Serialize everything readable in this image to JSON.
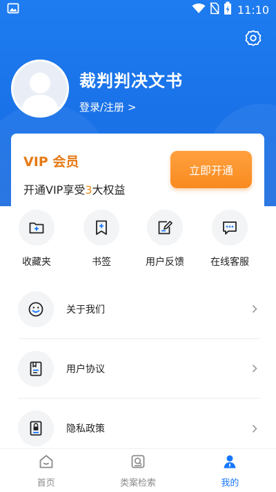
{
  "status_bar": {
    "time": "11:10"
  },
  "profile": {
    "app_title": "裁判判决文书",
    "login_text": "登录/注册 >"
  },
  "vip": {
    "title": "VIP 会员",
    "desc_prefix": "开通VIP享受",
    "desc_number": "3",
    "desc_suffix": "大权益",
    "button_label": "立即开通",
    "accent_color": "#f28a1c"
  },
  "quick_actions": [
    {
      "label": "收藏夹",
      "icon": "folder-plus-icon"
    },
    {
      "label": "书签",
      "icon": "bookmark-plus-icon"
    },
    {
      "label": "用户反馈",
      "icon": "feedback-edit-icon"
    },
    {
      "label": "在线客服",
      "icon": "chat-bubble-icon"
    }
  ],
  "menu": [
    {
      "label": "关于我们",
      "icon": "smiley-icon"
    },
    {
      "label": "用户协议",
      "icon": "agreement-document-icon"
    },
    {
      "label": "隐私政策",
      "icon": "privacy-lock-icon"
    }
  ],
  "bottom_nav": [
    {
      "label": "首页",
      "icon": "home-icon",
      "active": false
    },
    {
      "label": "类案检索",
      "icon": "case-search-icon",
      "active": false
    },
    {
      "label": "我的",
      "icon": "profile-icon",
      "active": true
    }
  ],
  "colors": {
    "primary": "#1a72e8",
    "active_tab": "#1677ff",
    "vip_orange": "#e67a15"
  }
}
